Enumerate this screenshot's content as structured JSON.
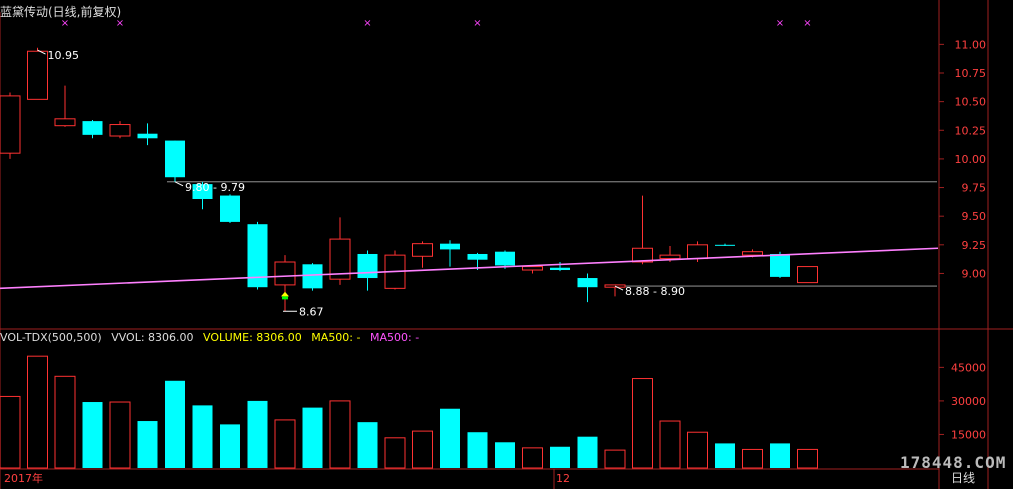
{
  "header": {
    "title": "蓝黛传动(日线,前复权)"
  },
  "volume_legend": {
    "name": "VOL-TDX(500,500)",
    "vvol": "VVOL: 8306.00",
    "volume": "VOLUME: 8306.00",
    "ma1": "MA500: -",
    "ma2": "MA500: -"
  },
  "footer": {
    "watermark": "178448.COM",
    "period": "日线"
  },
  "colors": {
    "background": "#000000",
    "up": "#ff3232",
    "down": "#00ffff",
    "ma_line": "#ff80ff",
    "axis": "#a02020",
    "volume_label": "#ffff00",
    "ma_label": "#ff55ff"
  },
  "chart_data": {
    "type": "candlestick",
    "title": "蓝黛传动(日线,前复权)",
    "y_price_ticks": [
      11.0,
      10.75,
      10.5,
      10.25,
      10.0,
      9.75,
      9.5,
      9.25,
      9.0
    ],
    "y_price_range": [
      8.55,
      11.3
    ],
    "y_volume_ticks": [
      45000,
      30000,
      15000
    ],
    "y_volume_range": [
      0,
      55000
    ],
    "x_labels": [
      {
        "text": "2017年",
        "index": 0
      },
      {
        "text": "12",
        "index": 20
      }
    ],
    "candles": [
      {
        "o": 10.05,
        "h": 10.58,
        "l": 10.0,
        "c": 10.55,
        "v": 32000
      },
      {
        "o": 10.52,
        "h": 10.97,
        "l": 10.52,
        "c": 10.94,
        "v": 50000
      },
      {
        "o": 10.29,
        "h": 10.64,
        "l": 10.28,
        "c": 10.35,
        "v": 41000
      },
      {
        "o": 10.33,
        "h": 10.34,
        "l": 10.18,
        "c": 10.21,
        "v": 29500
      },
      {
        "o": 10.2,
        "h": 10.33,
        "l": 10.18,
        "c": 10.3,
        "v": 29500
      },
      {
        "o": 10.22,
        "h": 10.31,
        "l": 10.12,
        "c": 10.18,
        "v": 21000
      },
      {
        "o": 10.16,
        "h": 10.16,
        "l": 9.8,
        "c": 9.84,
        "v": 39000
      },
      {
        "o": 9.78,
        "h": 9.8,
        "l": 9.56,
        "c": 9.65,
        "v": 28000
      },
      {
        "o": 9.68,
        "h": 9.69,
        "l": 9.44,
        "c": 9.45,
        "v": 19500
      },
      {
        "o": 9.43,
        "h": 9.45,
        "l": 8.86,
        "c": 8.88,
        "v": 30000
      },
      {
        "o": 8.9,
        "h": 9.16,
        "l": 8.67,
        "c": 9.1,
        "v": 21500
      },
      {
        "o": 9.08,
        "h": 9.09,
        "l": 8.85,
        "c": 8.87,
        "v": 27000
      },
      {
        "o": 8.95,
        "h": 9.49,
        "l": 8.9,
        "c": 9.3,
        "v": 30000
      },
      {
        "o": 9.17,
        "h": 9.2,
        "l": 8.85,
        "c": 8.96,
        "v": 20500
      },
      {
        "o": 8.87,
        "h": 9.2,
        "l": 8.86,
        "c": 9.16,
        "v": 13500
      },
      {
        "o": 9.15,
        "h": 9.28,
        "l": 9.05,
        "c": 9.26,
        "v": 16500
      },
      {
        "o": 9.26,
        "h": 9.29,
        "l": 9.06,
        "c": 9.21,
        "v": 26500
      },
      {
        "o": 9.17,
        "h": 9.18,
        "l": 9.03,
        "c": 9.12,
        "v": 16000
      },
      {
        "o": 9.19,
        "h": 9.2,
        "l": 9.04,
        "c": 9.07,
        "v": 11500
      },
      {
        "o": 9.03,
        "h": 9.06,
        "l": 9.0,
        "c": 9.06,
        "v": 9000
      },
      {
        "o": 9.05,
        "h": 9.1,
        "l": 9.02,
        "c": 9.03,
        "v": 9500
      },
      {
        "o": 8.96,
        "h": 9.0,
        "l": 8.75,
        "c": 8.88,
        "v": 14000
      },
      {
        "o": 8.88,
        "h": 8.9,
        "l": 8.8,
        "c": 8.9,
        "v": 8000
      },
      {
        "o": 9.1,
        "h": 9.68,
        "l": 9.08,
        "c": 9.22,
        "v": 40000
      },
      {
        "o": 9.13,
        "h": 9.24,
        "l": 9.1,
        "c": 9.16,
        "v": 21000
      },
      {
        "o": 9.13,
        "h": 9.28,
        "l": 9.1,
        "c": 9.25,
        "v": 16000
      },
      {
        "o": 9.25,
        "h": 9.26,
        "l": 9.24,
        "c": 9.245,
        "v": 11000
      },
      {
        "o": 9.16,
        "h": 9.21,
        "l": 9.14,
        "c": 9.19,
        "v": 8300
      },
      {
        "o": 9.17,
        "h": 9.19,
        "l": 8.96,
        "c": 8.97,
        "v": 11000
      },
      {
        "o": 8.92,
        "h": 9.06,
        "l": 8.92,
        "c": 9.06,
        "v": 8306
      }
    ],
    "ma_line": {
      "start": 8.87,
      "end": 9.22
    },
    "annotations": [
      {
        "text": "10.95",
        "candle": 1,
        "price": 10.95
      },
      {
        "text": "9.80 - 9.79",
        "candle": 6,
        "price": 9.8
      },
      {
        "text": "8.67",
        "candle": 10,
        "price": 8.67
      },
      {
        "text": "8.88 - 8.90",
        "candle": 22,
        "price": 8.89
      }
    ],
    "hlines": [
      {
        "price": 9.8,
        "from_candle": 6
      },
      {
        "price": 8.89,
        "from_candle": 22
      }
    ],
    "event_markers": [
      2,
      4,
      13,
      17,
      28,
      29
    ]
  }
}
